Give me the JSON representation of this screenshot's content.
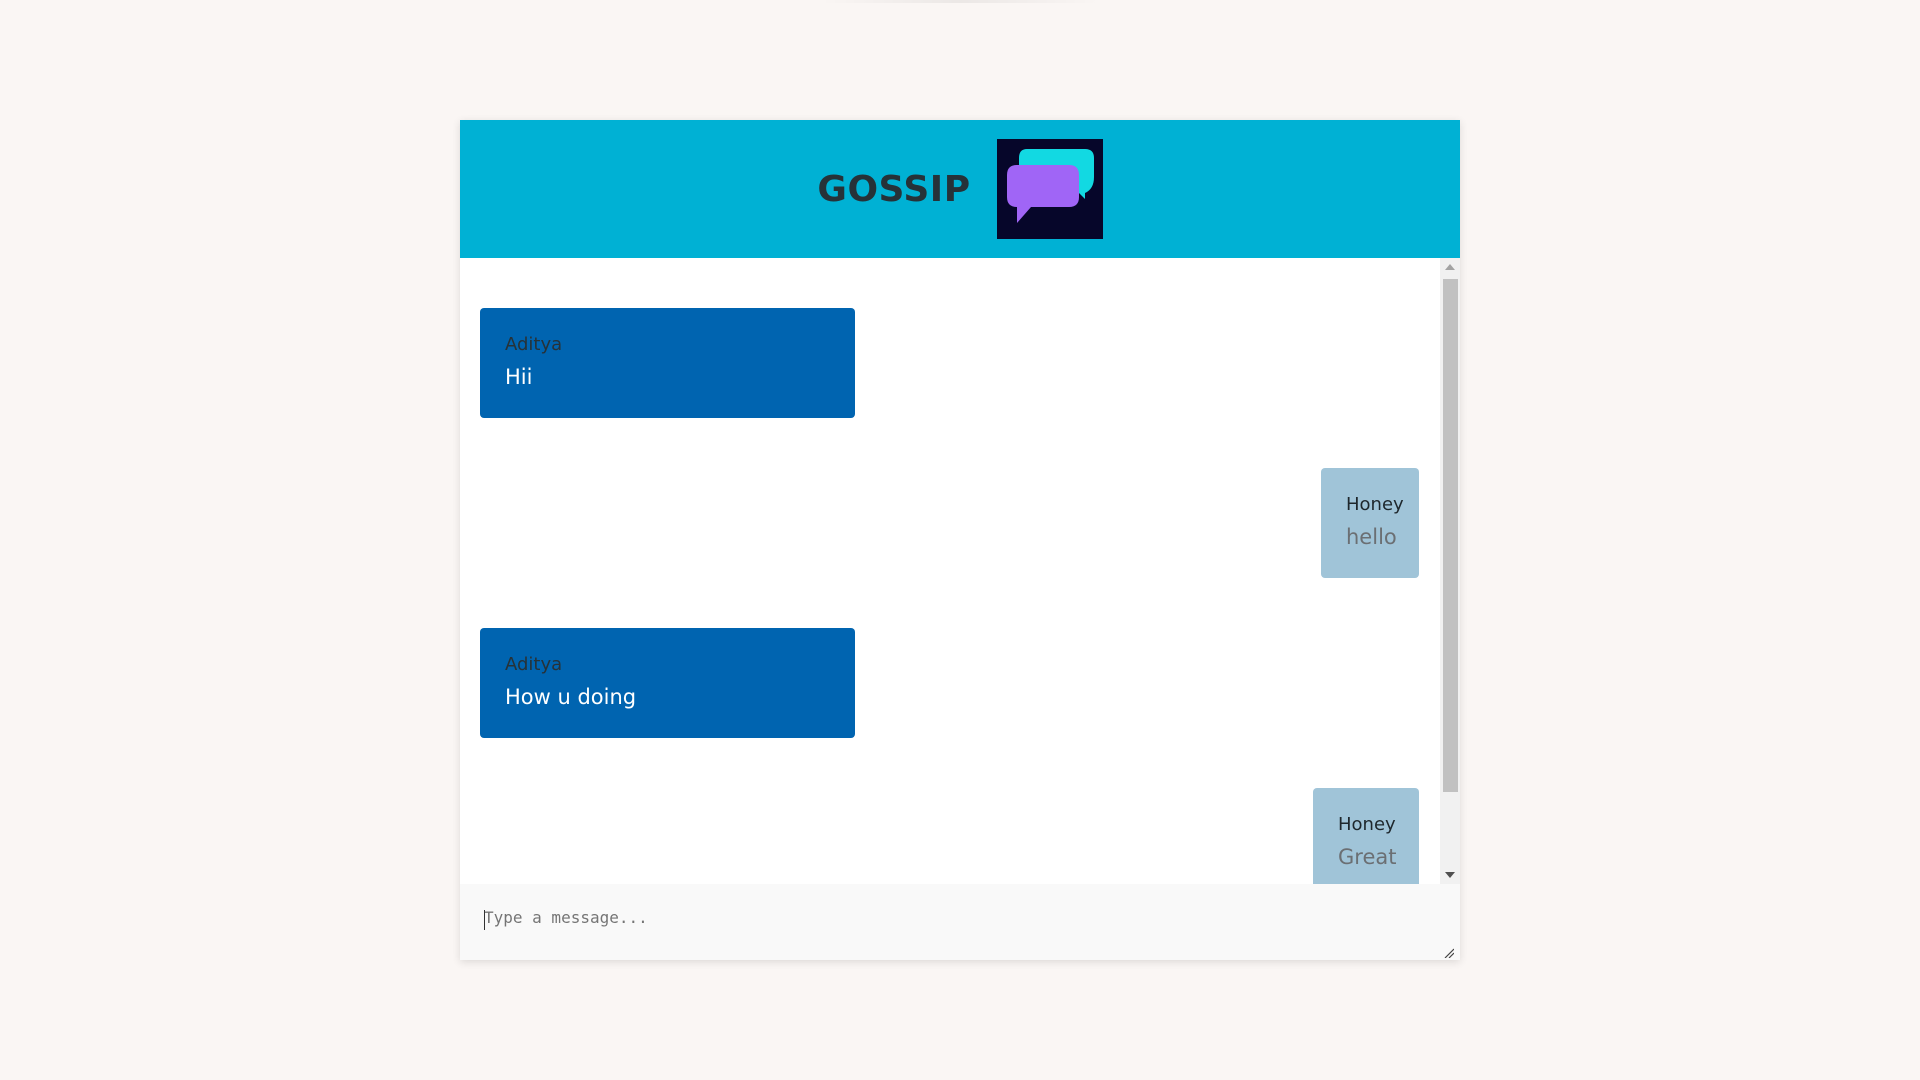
{
  "header": {
    "title": "GOSSIP",
    "logo_icon": "chat-bubbles-icon",
    "background_color": "#00b1d4"
  },
  "messages": [
    {
      "sender": "Aditya",
      "text": "Hii",
      "direction": "incoming"
    },
    {
      "sender": "Honey",
      "text": "hello",
      "direction": "outgoing"
    },
    {
      "sender": "Aditya",
      "text": "How u doing",
      "direction": "incoming"
    },
    {
      "sender": "Honey",
      "text": "Great",
      "direction": "outgoing"
    }
  ],
  "composer": {
    "placeholder": "Type a message...",
    "value": ""
  },
  "colors": {
    "incoming_bubble": "#0064b0",
    "outgoing_bubble": "#a0c4d8",
    "page_background": "#faf6f4"
  },
  "icons": {
    "scroll_up": "triangle-up-icon",
    "scroll_down": "triangle-down-icon",
    "resize": "resize-handle-icon"
  }
}
